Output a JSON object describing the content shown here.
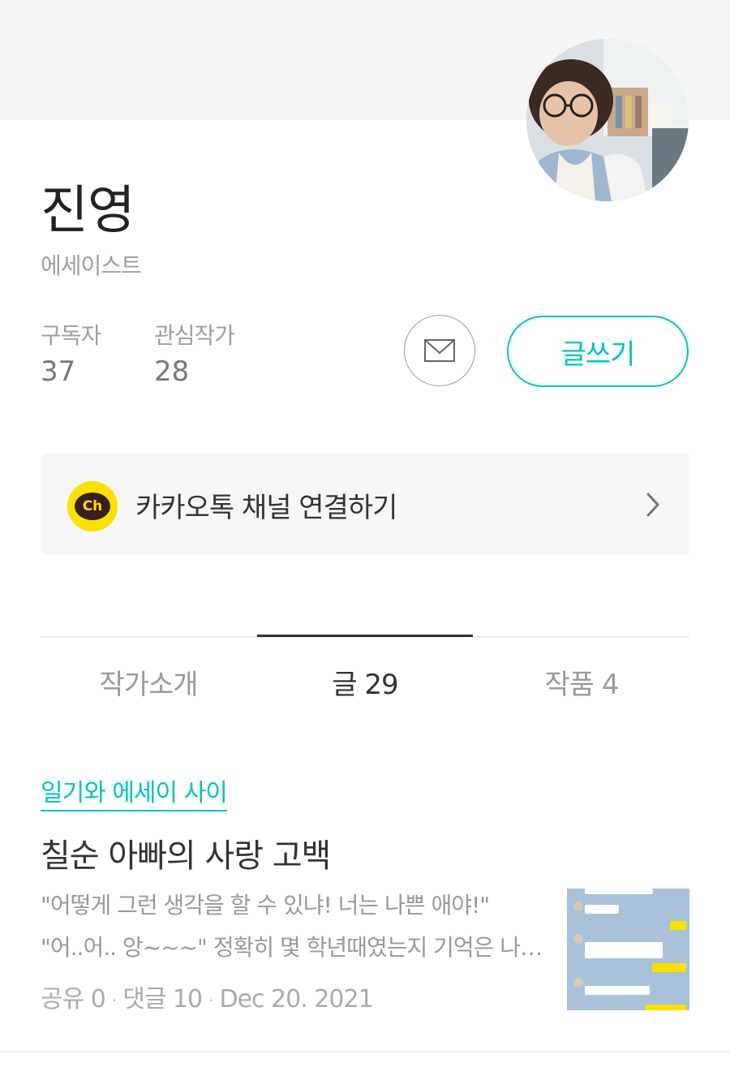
{
  "profile": {
    "name": "진영",
    "role": "에세이스트",
    "subscribers_label": "구독자",
    "subscribers_count": "37",
    "following_label": "관심작가",
    "following_count": "28",
    "write_button": "글쓰기"
  },
  "kakao": {
    "logo_text": "Ch",
    "label": "카카오톡 채널 연결하기"
  },
  "tabs": [
    {
      "label": "작가소개"
    },
    {
      "label": "글 29"
    },
    {
      "label": "작품 4"
    }
  ],
  "post": {
    "category": "일기와 에세이 사이",
    "title": "칠순 아빠의 사랑 고백",
    "excerpt_line1": "\"어떻게 그런 생각을  할 수 있냐! 너는 나쁜 애야!\"",
    "excerpt_line2": "\"어..어.. 앙~~~\"  정확히 몇 학년때였는지 기억은 나지 않는다.",
    "share": "공유 0",
    "comments": "댓글 10",
    "date": "Dec 20. 2021"
  },
  "colors": {
    "accent": "#00c3bd",
    "kakao_yellow": "#fae100"
  },
  "icons": [
    "mail-icon",
    "chevron-right-icon",
    "kakao-channel-icon"
  ]
}
